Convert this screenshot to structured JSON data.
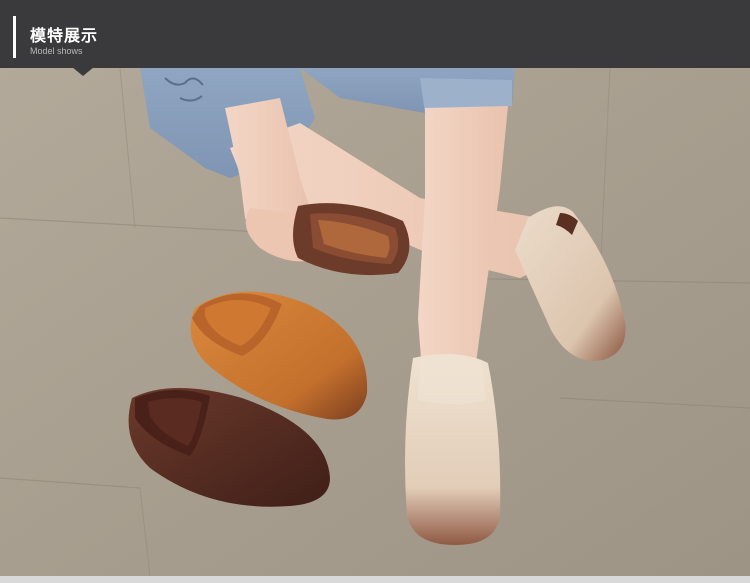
{
  "header": {
    "title": "模特展示",
    "subtitle": "Model shows",
    "bar_color": "#3a3a3c"
  },
  "photo": {
    "subject": "model wearing suede backless slippers",
    "slipper_colors": [
      "#e8d9c8",
      "#c9772f",
      "#5a2e22"
    ]
  }
}
